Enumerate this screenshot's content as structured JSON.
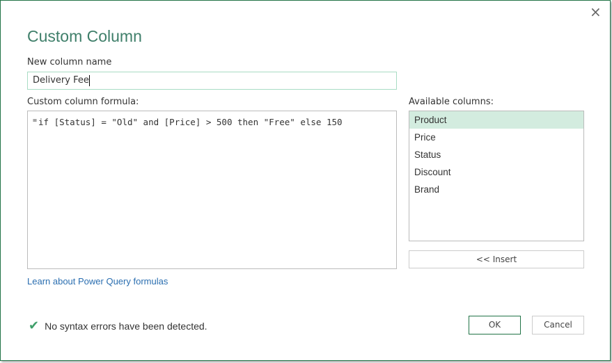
{
  "dialog": {
    "title": "Custom Column",
    "close_icon": "×",
    "new_column_label": "New column name",
    "new_column_value": "Delivery Fee",
    "formula_label": "Custom column formula:",
    "formula_prefix": "=",
    "formula_value": "if [Status] = \"Old\" and [Price] > 500 then \"Free\" else 150",
    "available_label": "Available columns:",
    "columns": [
      "Product",
      "Price",
      "Status",
      "Discount",
      "Brand"
    ],
    "insert_label": "<< Insert",
    "learn_link": "Learn about Power Query formulas",
    "status_icon": "✔",
    "status_text": "No syntax errors have been detected.",
    "ok_label": "OK",
    "cancel_label": "Cancel",
    "accent": "#217346"
  }
}
